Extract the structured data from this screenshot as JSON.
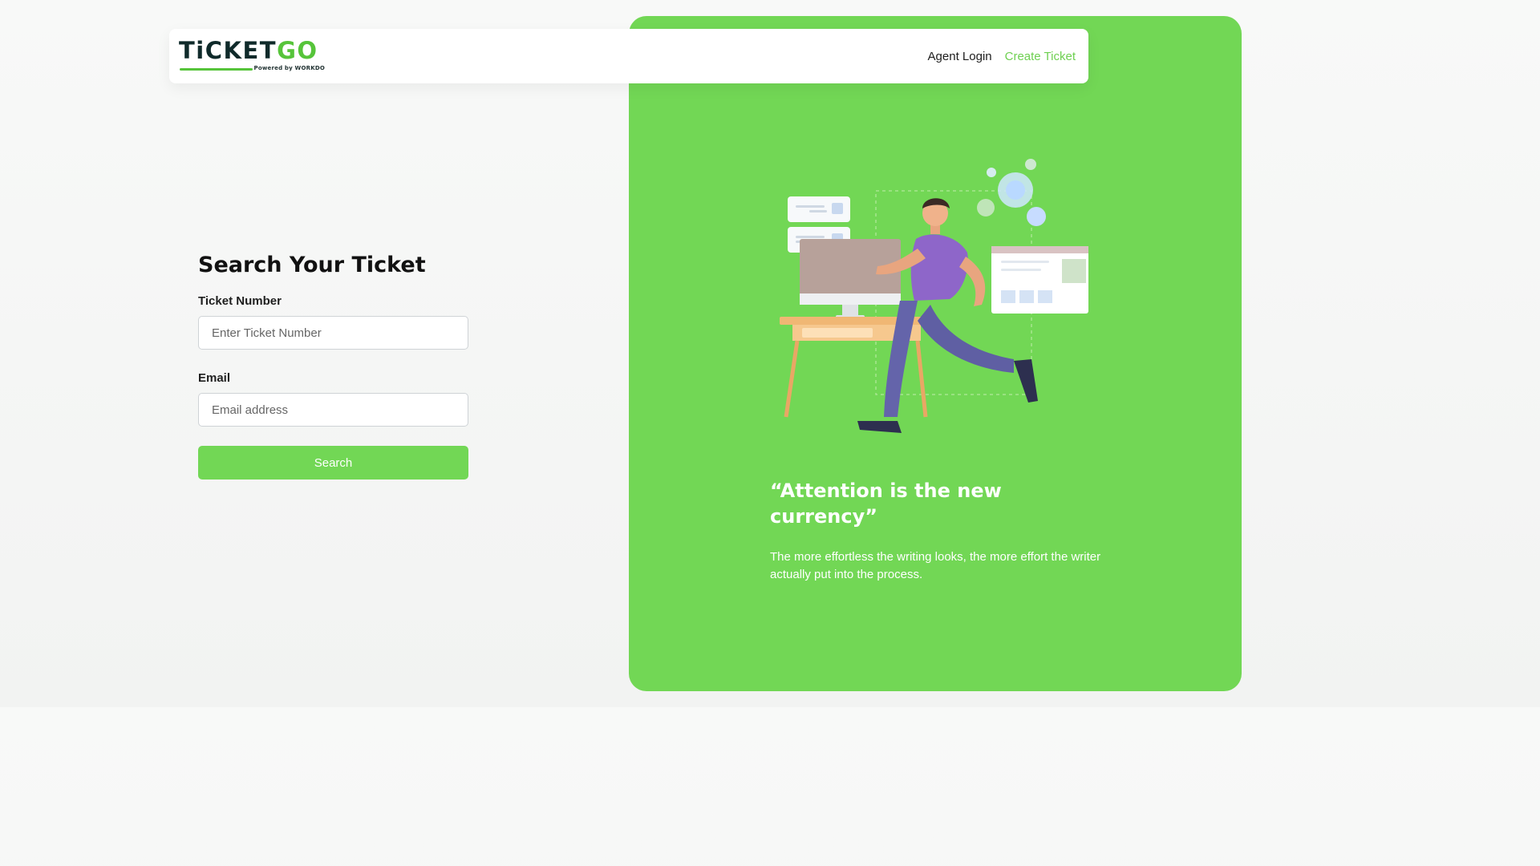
{
  "brand": {
    "logo_main": "TiCKET",
    "logo_accent": "GO",
    "logo_powered": "Powered by WORKDO"
  },
  "nav": {
    "agent_login": "Agent Login",
    "create_ticket": "Create Ticket"
  },
  "form": {
    "title": "Search Your Ticket",
    "ticket_label": "Ticket Number",
    "ticket_placeholder": "Enter Ticket Number",
    "ticket_value": "",
    "email_label": "Email",
    "email_placeholder": "Email address",
    "email_value": "",
    "search_label": "Search"
  },
  "quote": {
    "title": "“Attention is the new currency”",
    "body": "The more effortless the writing looks, the more effort the writer actually put into the process."
  },
  "colors": {
    "accent": "#72d755",
    "accent_dark": "#56c43a",
    "brand_dark": "#0f2a2a"
  },
  "icons": {
    "illustration": "person-running-at-desk-illustration"
  }
}
